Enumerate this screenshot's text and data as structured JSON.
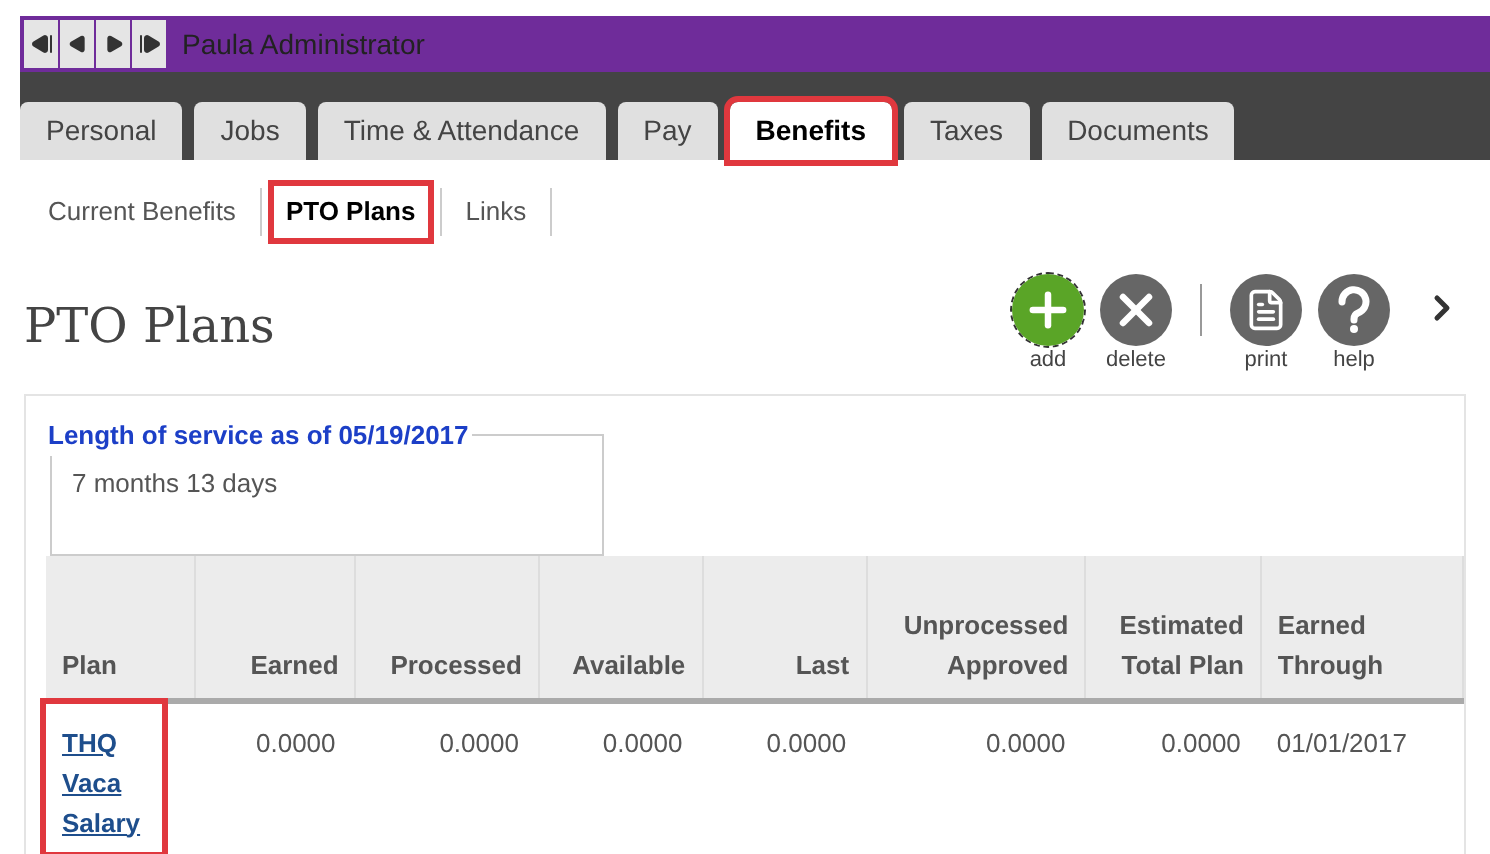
{
  "header": {
    "title": "Paula Administrator"
  },
  "tabs": [
    {
      "label": "Personal",
      "selected": false,
      "highlighted": false
    },
    {
      "label": "Jobs",
      "selected": false,
      "highlighted": false
    },
    {
      "label": "Time & Attendance",
      "selected": false,
      "highlighted": false
    },
    {
      "label": "Pay",
      "selected": false,
      "highlighted": false
    },
    {
      "label": "Benefits",
      "selected": true,
      "highlighted": true
    },
    {
      "label": "Taxes",
      "selected": false,
      "highlighted": false
    },
    {
      "label": "Documents",
      "selected": false,
      "highlighted": false
    }
  ],
  "subtabs": [
    {
      "label": "Current Benefits",
      "selected": false,
      "highlighted": false
    },
    {
      "label": "PTO Plans",
      "selected": true,
      "highlighted": true
    },
    {
      "label": "Links",
      "selected": false,
      "highlighted": false
    }
  ],
  "page_title": "PTO Plans",
  "toolbar": [
    {
      "kind": "add",
      "label": "add"
    },
    {
      "kind": "delete",
      "label": "delete"
    },
    {
      "kind": "print",
      "label": "print"
    },
    {
      "kind": "help",
      "label": "help"
    }
  ],
  "service": {
    "legend": "Length of service as of 05/19/2017",
    "value": "7 months 13 days"
  },
  "table": {
    "columns": [
      "Plan",
      "Earned",
      "Processed",
      "Available",
      "Last",
      "Unprocessed Approved",
      "Estimated Total Plan",
      "Earned Through"
    ],
    "rows": [
      {
        "plan_highlighted": true,
        "cells": [
          "THQ Vaca Salary",
          "0.0000",
          "0.0000",
          "0.0000",
          "0.0000",
          "0.0000",
          "0.0000",
          "01/01/2017"
        ]
      }
    ]
  }
}
